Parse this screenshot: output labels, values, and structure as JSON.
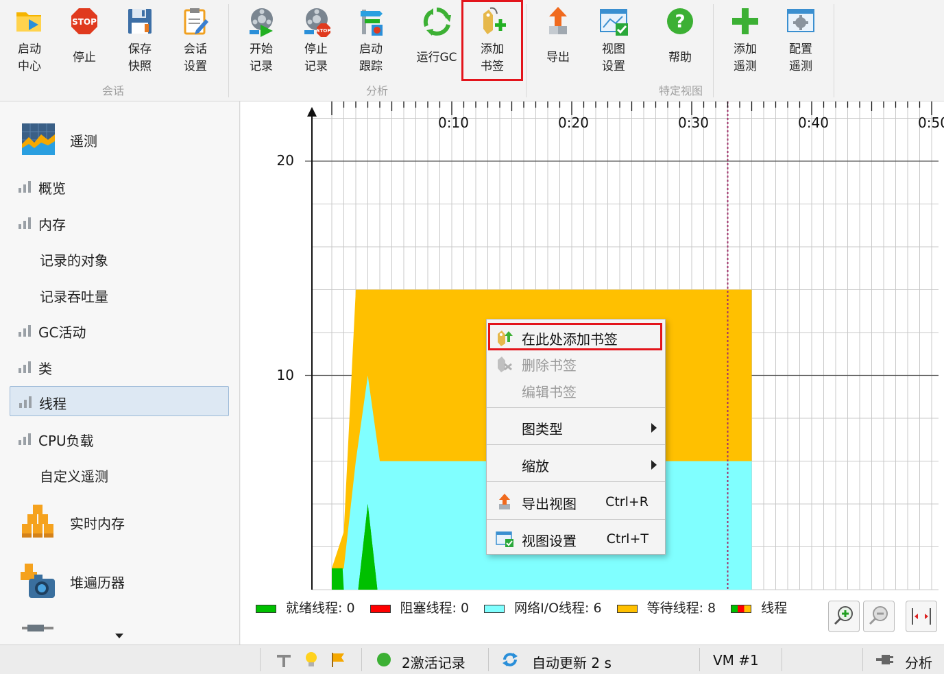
{
  "toolbar": {
    "buttons": [
      {
        "label": "启动\n中心",
        "icon": "start-center-icon"
      },
      {
        "label": "停止",
        "icon": "stop-icon"
      },
      {
        "label": "保存\n快照",
        "icon": "save-snapshot-icon"
      },
      {
        "label": "会话\n设置",
        "icon": "session-settings-icon"
      },
      {
        "label": "开始\n记录",
        "icon": "start-recording-icon"
      },
      {
        "label": "停止\n记录",
        "icon": "stop-recording-icon"
      },
      {
        "label": "启动\n跟踪",
        "icon": "start-tracking-icon"
      },
      {
        "label": "运行GC",
        "icon": "run-gc-icon"
      },
      {
        "label": "添加\n书签",
        "icon": "add-bookmark-icon"
      },
      {
        "label": "导出",
        "icon": "export-icon"
      },
      {
        "label": "视图\n设置",
        "icon": "view-settings-icon"
      },
      {
        "label": "帮助",
        "icon": "help-icon"
      },
      {
        "label": "添加\n遥测",
        "icon": "add-telemetry-icon"
      },
      {
        "label": "配置\n遥测",
        "icon": "configure-telemetry-icon"
      }
    ],
    "groups": [
      "会话",
      "分析",
      "特定视图"
    ]
  },
  "sidebar": {
    "telemetry_header": "遥测",
    "items": [
      {
        "label": "概览",
        "has_icon": true
      },
      {
        "label": "内存",
        "has_icon": true
      },
      {
        "label": "记录的对象",
        "has_icon": false
      },
      {
        "label": "记录吞吐量",
        "has_icon": false
      },
      {
        "label": "GC活动",
        "has_icon": true
      },
      {
        "label": "类",
        "has_icon": true
      },
      {
        "label": "线程",
        "has_icon": true,
        "selected": true
      },
      {
        "label": "CPU负载",
        "has_icon": true
      },
      {
        "label": "自定义遥测",
        "has_icon": false
      }
    ],
    "live_memory": "实时内存",
    "heap_walker": "堆遍历器"
  },
  "chart_data": {
    "type": "area",
    "stacked": true,
    "x_tick_labels": [
      "0:10",
      "0:20",
      "0:30",
      "0:40",
      "0:50"
    ],
    "x_unit": "seconds",
    "y_tick_labels": [
      "10",
      "20"
    ],
    "ylim": [
      0,
      20
    ],
    "xlim": [
      0,
      50
    ],
    "series": [
      {
        "name": "就绪线程",
        "color": "#00c000",
        "points": [
          [
            0,
            1.0
          ],
          [
            0.9,
            1.0
          ],
          [
            1.0,
            0
          ],
          [
            2.2,
            0
          ],
          [
            3.0,
            4.0
          ],
          [
            3.8,
            0
          ]
        ]
      },
      {
        "name": "网络I/O线程",
        "color": "#80ffff",
        "points": [
          [
            0,
            0.5
          ],
          [
            1.0,
            1.0
          ],
          [
            2.0,
            6.0
          ],
          [
            3.0,
            10.0
          ],
          [
            4.0,
            6.0
          ],
          [
            35.0,
            6.0
          ]
        ]
      },
      {
        "name": "等待线程",
        "color": "#ffc000",
        "points": [
          [
            0,
            1.0
          ],
          [
            1.0,
            2.7
          ],
          [
            2.0,
            14.0
          ],
          [
            35.0,
            14.0
          ]
        ]
      }
    ],
    "bookmark_x": 33.0,
    "grid": true
  },
  "legend": [
    {
      "label": "就绪线程: 0",
      "color": "#00c000"
    },
    {
      "label": "阻塞线程: 0",
      "color": "#ff0000"
    },
    {
      "label": "网络I/O线程: 6",
      "color": "#80ffff"
    },
    {
      "label": "等待线程: 8",
      "color": "#ffc000"
    },
    {
      "label": "线程",
      "color": "#ff0000"
    }
  ],
  "context_menu": {
    "items": [
      {
        "label": "在此处添加书签",
        "disabled": false,
        "icon": "add-bookmark-here-icon"
      },
      {
        "label": "删除书签",
        "disabled": true,
        "icon": "remove-bookmark-icon"
      },
      {
        "label": "编辑书签",
        "disabled": true
      },
      {
        "label": "图类型",
        "submenu": true
      },
      {
        "label": "缩放",
        "submenu": true
      },
      {
        "label": "导出视图",
        "shortcut": "Ctrl+R",
        "icon": "export-view-icon"
      },
      {
        "label": "视图设置",
        "shortcut": "Ctrl+T",
        "icon": "view-settings-menu-icon"
      }
    ]
  },
  "status_bar": {
    "recordings": "2激活记录",
    "auto_update": "自动更新 2 s",
    "vm": "VM #1",
    "mode": "分析"
  }
}
